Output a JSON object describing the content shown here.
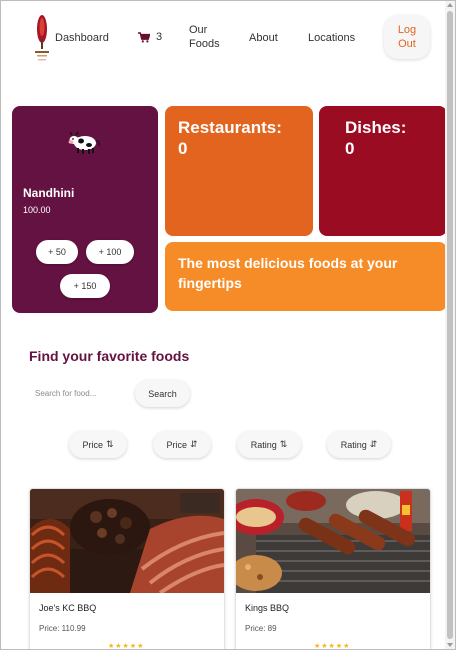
{
  "nav": {
    "dashboard": "Dashboard",
    "cart_count": "3",
    "our_foods_line1": "Our",
    "our_foods_line2": "Foods",
    "about": "About",
    "locations": "Locations",
    "logout_line1": "Log",
    "logout_line2": "Out"
  },
  "user_card": {
    "name": "Nandhini",
    "balance": "100.00",
    "add_buttons": [
      "+ 50",
      "+ 100",
      "+ 150"
    ]
  },
  "stats": {
    "restaurants_label": "Restaurants:",
    "restaurants_value": "0",
    "dishes_label": "Dishes:",
    "dishes_value": "0"
  },
  "tagline": "The most delicious foods at your fingertips",
  "find": {
    "title": "Find your favorite foods",
    "search_placeholder": "Search for food...",
    "search_button": "Search"
  },
  "sort_buttons": [
    {
      "label": "Price",
      "arrow": "⇅"
    },
    {
      "label": "Price",
      "arrow": "⇵"
    },
    {
      "label": "Rating",
      "arrow": "⇅"
    },
    {
      "label": "Rating",
      "arrow": "⇵"
    }
  ],
  "foods": [
    {
      "name": "Joe's KC BBQ",
      "price": "Price: 110.99",
      "stars": "★★★★★"
    },
    {
      "name": "Kings BBQ",
      "price": "Price: 89",
      "stars": "★★★★★"
    }
  ],
  "colors": {
    "plum": "#631241",
    "orange": "#e2641e",
    "crimson": "#9a0c22",
    "amber": "#f68c28",
    "star": "#f2b71a"
  }
}
